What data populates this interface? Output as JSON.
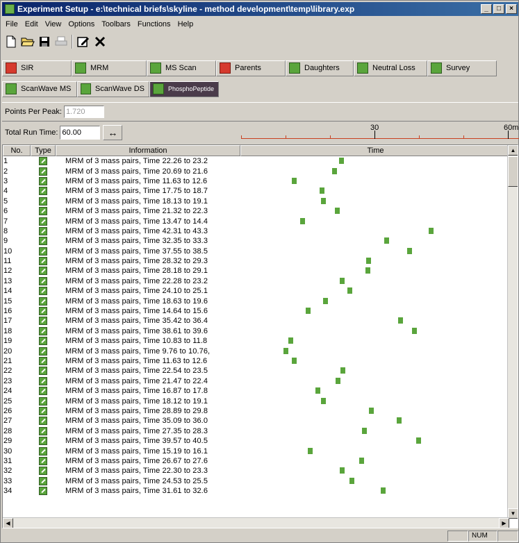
{
  "window": {
    "title": "Experiment Setup - e:\\technical briefs\\skyline - method development\\temp\\library.exp",
    "minimize": "_",
    "maximize": "□",
    "close": "×"
  },
  "menu": [
    "File",
    "Edit",
    "View",
    "Options",
    "Toolbars",
    "Functions",
    "Help"
  ],
  "toolbar_icons": [
    "new-file-icon",
    "open-folder-icon",
    "save-icon",
    "print-icon",
    "edit-icon",
    "delete-icon"
  ],
  "scan_types": [
    {
      "label": "SIR",
      "color": "red"
    },
    {
      "label": "MRM",
      "color": "green"
    },
    {
      "label": "MS Scan",
      "color": "green"
    },
    {
      "label": "Parents",
      "color": "red"
    },
    {
      "label": "Daughters",
      "color": "green"
    },
    {
      "label": "Neutral Loss",
      "color": "green"
    },
    {
      "label": "Survey",
      "color": "green"
    }
  ],
  "scan_types2": [
    {
      "label": "ScanWave MS",
      "color": "green"
    },
    {
      "label": "ScanWave DS",
      "color": "green"
    },
    {
      "label": "PhosphoPeptide",
      "color": "dark"
    }
  ],
  "points_per_peak": {
    "label": "Points Per Peak:",
    "value": "1.720"
  },
  "total_run_time": {
    "label": "Total Run Time:",
    "value": "60.00",
    "max_minutes": 60
  },
  "ruler": {
    "mid_label": "30",
    "end_label": "60m"
  },
  "columns": [
    "No.",
    "Type",
    "Information",
    "Time"
  ],
  "functions": [
    {
      "no": "1",
      "info": "MRM of 3 mass pairs, Time 22.26 to 23.2",
      "start": 22.26
    },
    {
      "no": "2",
      "info": "MRM of 3 mass pairs, Time 20.69 to 21.6",
      "start": 20.69
    },
    {
      "no": "3",
      "info": "MRM of 3 mass pairs, Time 11.63 to 12.6",
      "start": 11.63
    },
    {
      "no": "4",
      "info": "MRM of 3 mass pairs, Time 17.75 to 18.7",
      "start": 17.75
    },
    {
      "no": "5",
      "info": "MRM of 3 mass pairs, Time 18.13 to 19.1",
      "start": 18.13
    },
    {
      "no": "6",
      "info": "MRM of 3 mass pairs, Time 21.32 to 22.3",
      "start": 21.32
    },
    {
      "no": "7",
      "info": "MRM of 3 mass pairs, Time 13.47 to 14.4",
      "start": 13.47
    },
    {
      "no": "8",
      "info": "MRM of 3 mass pairs, Time 42.31 to 43.3",
      "start": 42.31
    },
    {
      "no": "9",
      "info": "MRM of 3 mass pairs, Time 32.35 to 33.3",
      "start": 32.35
    },
    {
      "no": "10",
      "info": "MRM of 3 mass pairs, Time 37.55 to 38.5",
      "start": 37.55
    },
    {
      "no": "11",
      "info": "MRM of 3 mass pairs, Time 28.32 to 29.3",
      "start": 28.32
    },
    {
      "no": "12",
      "info": "MRM of 3 mass pairs, Time 28.18 to 29.1",
      "start": 28.18
    },
    {
      "no": "13",
      "info": "MRM of 3 mass pairs, Time 22.28 to 23.2",
      "start": 22.28
    },
    {
      "no": "14",
      "info": "MRM of 3 mass pairs, Time 24.10 to 25.1",
      "start": 24.1
    },
    {
      "no": "15",
      "info": "MRM of 3 mass pairs, Time 18.63 to 19.6",
      "start": 18.63
    },
    {
      "no": "16",
      "info": "MRM of 3 mass pairs, Time 14.64 to 15.6",
      "start": 14.64
    },
    {
      "no": "17",
      "info": "MRM of 3 mass pairs, Time 35.42 to 36.4",
      "start": 35.42
    },
    {
      "no": "18",
      "info": "MRM of 3 mass pairs, Time 38.61 to 39.6",
      "start": 38.61
    },
    {
      "no": "19",
      "info": "MRM of 3 mass pairs, Time 10.83 to 11.8",
      "start": 10.83
    },
    {
      "no": "20",
      "info": "MRM of 3 mass pairs, Time 9.76 to 10.76,",
      "start": 9.76
    },
    {
      "no": "21",
      "info": "MRM of 3 mass pairs, Time 11.63 to 12.6",
      "start": 11.63
    },
    {
      "no": "22",
      "info": "MRM of 3 mass pairs, Time 22.54 to 23.5",
      "start": 22.54
    },
    {
      "no": "23",
      "info": "MRM of 3 mass pairs, Time 21.47 to 22.4",
      "start": 21.47
    },
    {
      "no": "24",
      "info": "MRM of 3 mass pairs, Time 16.87 to 17.8",
      "start": 16.87
    },
    {
      "no": "25",
      "info": "MRM of 3 mass pairs, Time 18.12 to 19.1",
      "start": 18.12
    },
    {
      "no": "26",
      "info": "MRM of 3 mass pairs, Time 28.89 to 29.8",
      "start": 28.89
    },
    {
      "no": "27",
      "info": "MRM of 3 mass pairs, Time 35.09 to 36.0",
      "start": 35.09
    },
    {
      "no": "28",
      "info": "MRM of 3 mass pairs, Time 27.35 to 28.3",
      "start": 27.35
    },
    {
      "no": "29",
      "info": "MRM of 3 mass pairs, Time 39.57 to 40.5",
      "start": 39.57
    },
    {
      "no": "30",
      "info": "MRM of 3 mass pairs, Time 15.19 to 16.1",
      "start": 15.19
    },
    {
      "no": "31",
      "info": "MRM of 3 mass pairs, Time 26.67 to 27.6",
      "start": 26.67
    },
    {
      "no": "32",
      "info": "MRM of 3 mass pairs, Time 22.30 to 23.3",
      "start": 22.3
    },
    {
      "no": "33",
      "info": "MRM of 3 mass pairs, Time 24.53 to 25.5",
      "start": 24.53
    },
    {
      "no": "34",
      "info": "MRM of 3 mass pairs, Time 31.61 to 32.6",
      "start": 31.61
    }
  ],
  "status": {
    "num": "NUM"
  },
  "colors": {
    "marker": "#5aa53c",
    "titlebar": "#0a246a",
    "ruler": "#c84020"
  }
}
